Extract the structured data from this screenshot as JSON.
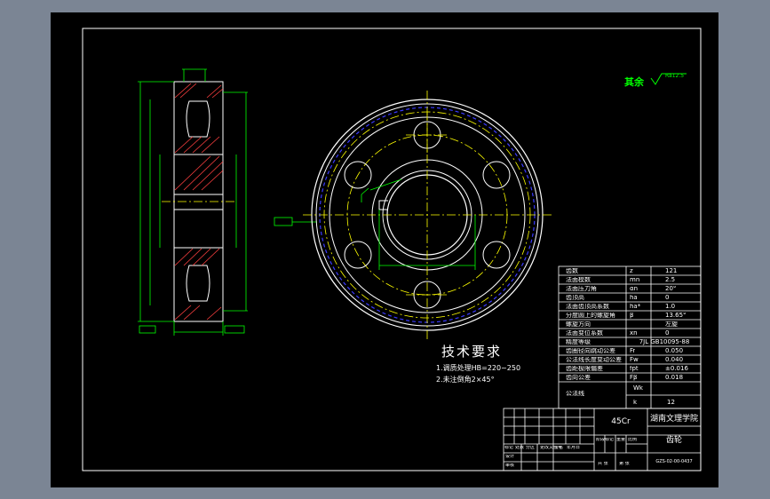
{
  "notes": {
    "title": "技术要求",
    "items": [
      "1.调质处理HB=220~250",
      "2.未注倒角2×45°"
    ]
  },
  "roughness": {
    "label": "其余",
    "value": "Ra12.5"
  },
  "params": {
    "rows": [
      {
        "name": "齿数",
        "sym": "z",
        "val": "121"
      },
      {
        "name": "法面模数",
        "sym": "mn",
        "val": "2.5"
      },
      {
        "name": "法面压力角",
        "sym": "αn",
        "val": "20°"
      },
      {
        "name": "齿顶高",
        "sym": "ha",
        "val": "0"
      },
      {
        "name": "法面齿顶高系数",
        "sym": "ha*",
        "val": "1.0"
      },
      {
        "name": "分度圆上的螺旋角",
        "sym": "β",
        "val": "13.65°"
      },
      {
        "name": "螺旋方向",
        "sym": "",
        "val": "左旋"
      },
      {
        "name": "法面变位系数",
        "sym": "xn",
        "val": "0"
      },
      {
        "name": "精度等级",
        "sym": "",
        "val": "7JL GB10095-88"
      },
      {
        "name": "齿圈径向跳动公差",
        "sym": "Fr",
        "val": "0.050"
      },
      {
        "name": "公法线长度变动公差",
        "sym": "Fw",
        "val": "0.040"
      },
      {
        "name": "齿距极限偏差",
        "sym": "fpt",
        "val": "±0.016"
      },
      {
        "name": "齿向公差",
        "sym": "Fβ",
        "val": "0.018"
      },
      {
        "name": "公法线",
        "sym": "Wk",
        "val": ""
      },
      {
        "name": "",
        "sym": "k",
        "val": "12"
      }
    ]
  },
  "titleblock": {
    "material": "45Cr",
    "school": "湖南文理学院",
    "part": "齿轮",
    "drawing_no": "GZS-02-00-0437",
    "labels": [
      "标记",
      "处数",
      "分区",
      "更改文件号",
      "签名",
      "年月日",
      "设计",
      "审核",
      "阶段标记",
      "重量",
      "比例",
      "共 张",
      "第 张"
    ]
  },
  "colors": {
    "background": "#000000",
    "outline": "#ffffff",
    "dimension": "#00ff00",
    "center": "#ffff00",
    "hidden": "#0000ff",
    "hatch": "#ff0000",
    "frame": "#7b8594"
  }
}
